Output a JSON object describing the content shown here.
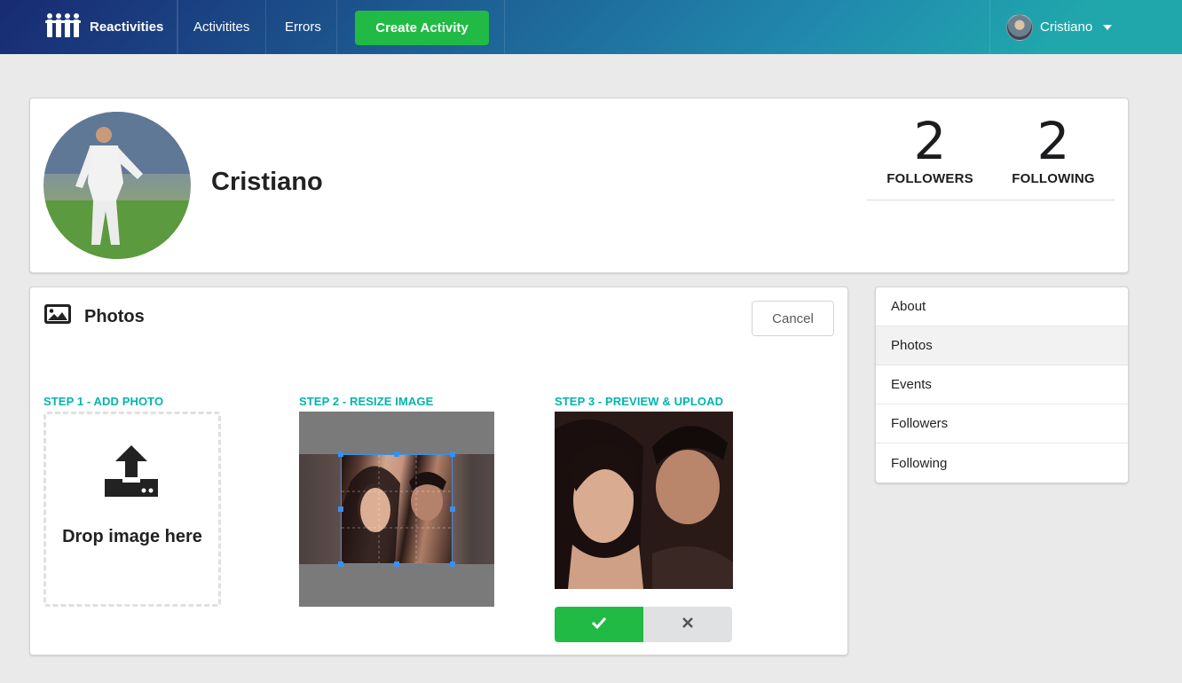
{
  "navbar": {
    "brand": "Reactivities",
    "activities": "Activitites",
    "errors": "Errors",
    "create_activity": "Create Activity",
    "user_name": "Cristiano"
  },
  "profile": {
    "name": "Cristiano",
    "followers_count": "2",
    "followers_label": "FOLLOWERS",
    "following_count": "2",
    "following_label": "FOLLOWING"
  },
  "photos": {
    "title": "Photos",
    "cancel": "Cancel",
    "step1": "STEP 1 - ADD PHOTO",
    "step2": "STEP 2 - RESIZE IMAGE",
    "step3": "STEP 3 - PREVIEW & UPLOAD",
    "dropzone_text": "Drop image here"
  },
  "side_menu": {
    "items": [
      "About",
      "Photos",
      "Events",
      "Followers",
      "Following"
    ],
    "active": "Photos"
  },
  "colors": {
    "accent_green": "#21ba45",
    "step_teal": "#00b5ad",
    "nav_gradient_start": "#182a73",
    "nav_gradient_end": "#20a7ac"
  },
  "icons": [
    "users-logo-icon",
    "caret-down-icon",
    "image-icon",
    "upload-icon",
    "check-icon",
    "close-icon"
  ]
}
